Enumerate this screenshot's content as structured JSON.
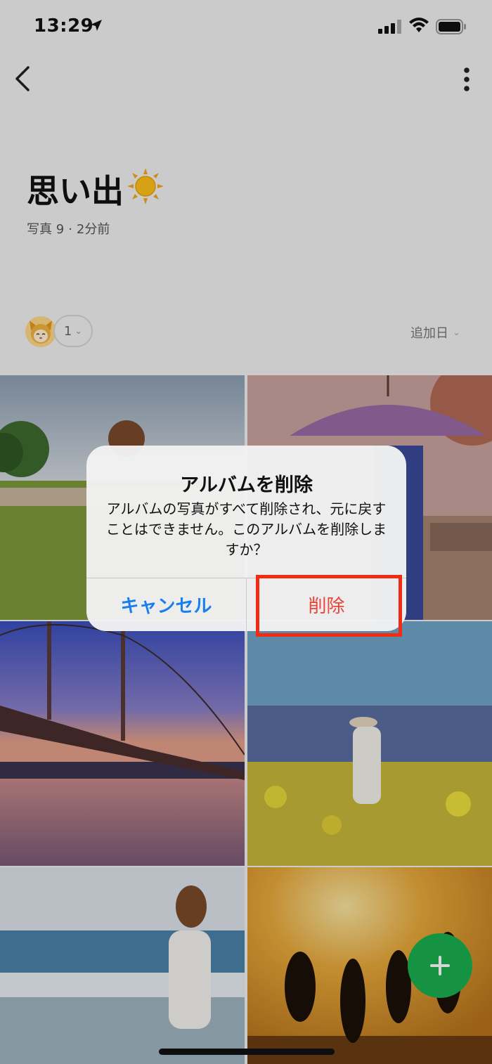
{
  "status_bar": {
    "time": "13:29"
  },
  "header": {
    "title": "思い出",
    "meta_photos": "写真 9",
    "meta_separator": "·",
    "meta_updated": "2分前"
  },
  "members": {
    "count": "1",
    "chevron": "⌄"
  },
  "sort": {
    "label": "追加日",
    "chevron": "⌄"
  },
  "photos": [
    {
      "subject": "girl-in-flower-field"
    },
    {
      "subject": "kimono-girl-with-umbrella"
    },
    {
      "subject": "suspension-bridge-at-dusk"
    },
    {
      "subject": "girl-in-rapeseed-field"
    },
    {
      "subject": "girl-on-beach"
    },
    {
      "subject": "people-jumping-at-sunset"
    }
  ],
  "dialog": {
    "title": "アルバムを削除",
    "message": "アルバムの写真がすべて削除され、元に戻すことはできません。このアルバムを削除しますか？",
    "cancel_label": "キャンセル",
    "delete_label": "削除"
  },
  "colors": {
    "accent_blue": "#1a7ef0",
    "destructive_red": "#e8453b",
    "fab_green": "#1bb04f",
    "highlight_red": "#f12b14"
  },
  "icons": {
    "back": "chevron-left-icon",
    "more": "more-vertical-icon",
    "add": "plus-icon",
    "location": "location-arrow-icon"
  }
}
